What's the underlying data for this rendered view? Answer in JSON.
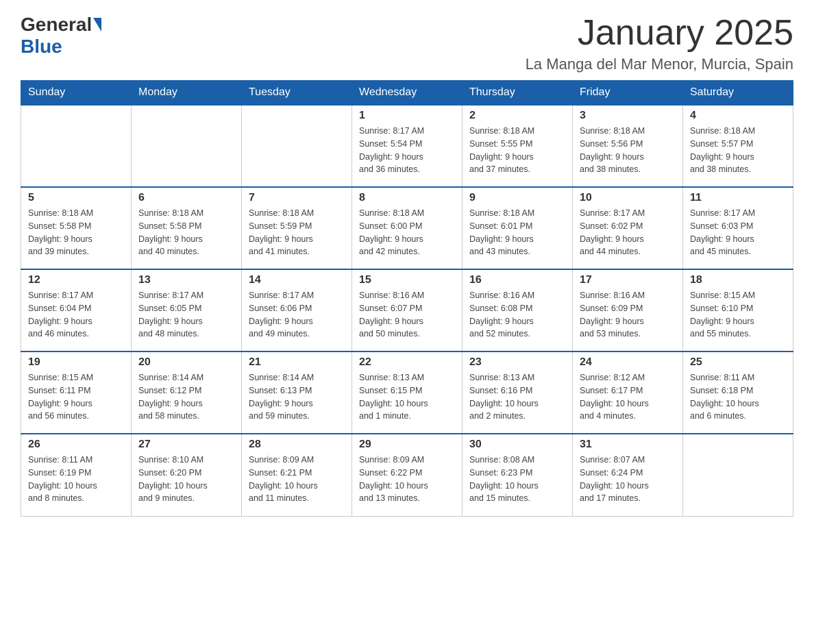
{
  "header": {
    "logo_general": "General",
    "logo_blue": "Blue",
    "month_title": "January 2025",
    "location": "La Manga del Mar Menor, Murcia, Spain"
  },
  "weekdays": [
    "Sunday",
    "Monday",
    "Tuesday",
    "Wednesday",
    "Thursday",
    "Friday",
    "Saturday"
  ],
  "weeks": [
    [
      {
        "day": "",
        "info": ""
      },
      {
        "day": "",
        "info": ""
      },
      {
        "day": "",
        "info": ""
      },
      {
        "day": "1",
        "info": "Sunrise: 8:17 AM\nSunset: 5:54 PM\nDaylight: 9 hours\nand 36 minutes."
      },
      {
        "day": "2",
        "info": "Sunrise: 8:18 AM\nSunset: 5:55 PM\nDaylight: 9 hours\nand 37 minutes."
      },
      {
        "day": "3",
        "info": "Sunrise: 8:18 AM\nSunset: 5:56 PM\nDaylight: 9 hours\nand 38 minutes."
      },
      {
        "day": "4",
        "info": "Sunrise: 8:18 AM\nSunset: 5:57 PM\nDaylight: 9 hours\nand 38 minutes."
      }
    ],
    [
      {
        "day": "5",
        "info": "Sunrise: 8:18 AM\nSunset: 5:58 PM\nDaylight: 9 hours\nand 39 minutes."
      },
      {
        "day": "6",
        "info": "Sunrise: 8:18 AM\nSunset: 5:58 PM\nDaylight: 9 hours\nand 40 minutes."
      },
      {
        "day": "7",
        "info": "Sunrise: 8:18 AM\nSunset: 5:59 PM\nDaylight: 9 hours\nand 41 minutes."
      },
      {
        "day": "8",
        "info": "Sunrise: 8:18 AM\nSunset: 6:00 PM\nDaylight: 9 hours\nand 42 minutes."
      },
      {
        "day": "9",
        "info": "Sunrise: 8:18 AM\nSunset: 6:01 PM\nDaylight: 9 hours\nand 43 minutes."
      },
      {
        "day": "10",
        "info": "Sunrise: 8:17 AM\nSunset: 6:02 PM\nDaylight: 9 hours\nand 44 minutes."
      },
      {
        "day": "11",
        "info": "Sunrise: 8:17 AM\nSunset: 6:03 PM\nDaylight: 9 hours\nand 45 minutes."
      }
    ],
    [
      {
        "day": "12",
        "info": "Sunrise: 8:17 AM\nSunset: 6:04 PM\nDaylight: 9 hours\nand 46 minutes."
      },
      {
        "day": "13",
        "info": "Sunrise: 8:17 AM\nSunset: 6:05 PM\nDaylight: 9 hours\nand 48 minutes."
      },
      {
        "day": "14",
        "info": "Sunrise: 8:17 AM\nSunset: 6:06 PM\nDaylight: 9 hours\nand 49 minutes."
      },
      {
        "day": "15",
        "info": "Sunrise: 8:16 AM\nSunset: 6:07 PM\nDaylight: 9 hours\nand 50 minutes."
      },
      {
        "day": "16",
        "info": "Sunrise: 8:16 AM\nSunset: 6:08 PM\nDaylight: 9 hours\nand 52 minutes."
      },
      {
        "day": "17",
        "info": "Sunrise: 8:16 AM\nSunset: 6:09 PM\nDaylight: 9 hours\nand 53 minutes."
      },
      {
        "day": "18",
        "info": "Sunrise: 8:15 AM\nSunset: 6:10 PM\nDaylight: 9 hours\nand 55 minutes."
      }
    ],
    [
      {
        "day": "19",
        "info": "Sunrise: 8:15 AM\nSunset: 6:11 PM\nDaylight: 9 hours\nand 56 minutes."
      },
      {
        "day": "20",
        "info": "Sunrise: 8:14 AM\nSunset: 6:12 PM\nDaylight: 9 hours\nand 58 minutes."
      },
      {
        "day": "21",
        "info": "Sunrise: 8:14 AM\nSunset: 6:13 PM\nDaylight: 9 hours\nand 59 minutes."
      },
      {
        "day": "22",
        "info": "Sunrise: 8:13 AM\nSunset: 6:15 PM\nDaylight: 10 hours\nand 1 minute."
      },
      {
        "day": "23",
        "info": "Sunrise: 8:13 AM\nSunset: 6:16 PM\nDaylight: 10 hours\nand 2 minutes."
      },
      {
        "day": "24",
        "info": "Sunrise: 8:12 AM\nSunset: 6:17 PM\nDaylight: 10 hours\nand 4 minutes."
      },
      {
        "day": "25",
        "info": "Sunrise: 8:11 AM\nSunset: 6:18 PM\nDaylight: 10 hours\nand 6 minutes."
      }
    ],
    [
      {
        "day": "26",
        "info": "Sunrise: 8:11 AM\nSunset: 6:19 PM\nDaylight: 10 hours\nand 8 minutes."
      },
      {
        "day": "27",
        "info": "Sunrise: 8:10 AM\nSunset: 6:20 PM\nDaylight: 10 hours\nand 9 minutes."
      },
      {
        "day": "28",
        "info": "Sunrise: 8:09 AM\nSunset: 6:21 PM\nDaylight: 10 hours\nand 11 minutes."
      },
      {
        "day": "29",
        "info": "Sunrise: 8:09 AM\nSunset: 6:22 PM\nDaylight: 10 hours\nand 13 minutes."
      },
      {
        "day": "30",
        "info": "Sunrise: 8:08 AM\nSunset: 6:23 PM\nDaylight: 10 hours\nand 15 minutes."
      },
      {
        "day": "31",
        "info": "Sunrise: 8:07 AM\nSunset: 6:24 PM\nDaylight: 10 hours\nand 17 minutes."
      },
      {
        "day": "",
        "info": ""
      }
    ]
  ]
}
